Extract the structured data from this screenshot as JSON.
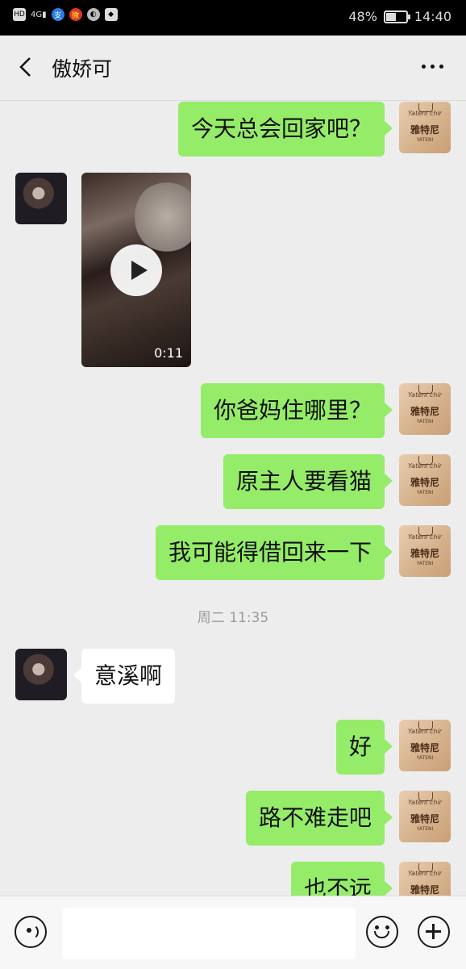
{
  "status_bar": {
    "left_icons": [
      "HD",
      "4G",
      "signal",
      "fish",
      "weibo",
      "wechat",
      "shield"
    ],
    "battery_percent": "48%",
    "battery_fill": 0.48,
    "time": "14:40"
  },
  "header": {
    "back_icon": "chevron-left-icon",
    "title": "傲娇可",
    "more_icon": "more-dots-icon"
  },
  "avatar_me": {
    "brand_script": "Yateni chir",
    "brand_cn": "雅特尼",
    "brand_sub": "YATENI"
  },
  "messages": [
    {
      "from": "me",
      "type": "text",
      "text": "今天总会回家吧？"
    },
    {
      "from": "her",
      "type": "video",
      "duration": "0:11"
    },
    {
      "from": "me",
      "type": "text",
      "text": "你爸妈住哪里？"
    },
    {
      "from": "me",
      "type": "text",
      "text": "原主人要看猫"
    },
    {
      "from": "me",
      "type": "text",
      "text": "我可能得借回来一下"
    },
    {
      "type": "timestamp",
      "text": "周二 11:35"
    },
    {
      "from": "her",
      "type": "text",
      "text": "意溪啊"
    },
    {
      "from": "me",
      "type": "text",
      "text": "好"
    },
    {
      "from": "me",
      "type": "text",
      "text": "路不难走吧"
    },
    {
      "from": "me",
      "type": "text",
      "text": "也不远"
    }
  ],
  "input_bar": {
    "voice_icon": "voice-icon",
    "emoji_icon": "emoji-icon",
    "plus_icon": "plus-icon",
    "input_value": ""
  },
  "colors": {
    "my_bubble": "#95ec69",
    "her_bubble": "#ffffff",
    "background": "#ededed"
  }
}
